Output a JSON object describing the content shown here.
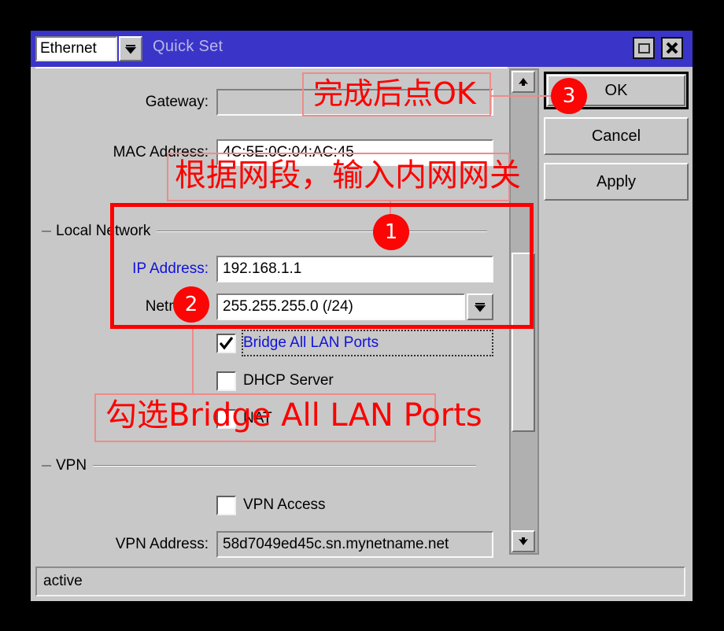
{
  "window": {
    "title": "Quick Set",
    "interface_selected": "Ethernet",
    "interface_dropdown_icon": "chevron-down-icon",
    "maximize_icon": "maximize-icon",
    "close_icon": "close-icon",
    "status": "active"
  },
  "form": {
    "gateway": {
      "label": "Gateway:",
      "value": ""
    },
    "mac_address": {
      "label": "MAC Address:",
      "value": "4C:5E:0C:04:AC:45"
    },
    "local_network_section": "Local Network",
    "ip_address": {
      "label": "IP Address:",
      "value": "192.168.1.1"
    },
    "netmask": {
      "label": "Netmask:",
      "value": "255.255.255.0 (/24)",
      "dropdown_icon": "chevron-down-icon"
    },
    "bridge_all_lan_ports": {
      "label": "Bridge All LAN Ports",
      "checked": true,
      "check_icon": "check-icon"
    },
    "dhcp_server": {
      "label": "DHCP Server",
      "checked": false
    },
    "nat": {
      "label": "NAT",
      "checked": false
    },
    "vpn_section": "VPN",
    "vpn_access": {
      "label": "VPN Access",
      "checked": false
    },
    "vpn_address": {
      "label": "VPN Address:",
      "value": "58d7049ed45c.sn.mynetname.net"
    }
  },
  "buttons": {
    "ok": "OK",
    "cancel": "Cancel",
    "apply": "Apply"
  },
  "scrollbar": {
    "up_icon": "arrow-up-icon",
    "down_icon": "arrow-down-icon"
  },
  "annotations": {
    "step1_badge": "1",
    "step2_badge": "2",
    "step3_badge": "3",
    "note_ok": "完成后点OK",
    "note_gateway": "根据网段，输入内网网关",
    "note_bridge": "勾选Bridge All LAN Ports"
  },
  "colors": {
    "titlebar": "#3a35c8",
    "window_face": "#c8c8c8",
    "annotation_red": "#fc0000",
    "annotation_light_red": "#f08a8a",
    "label_blue": "#1111dd"
  }
}
